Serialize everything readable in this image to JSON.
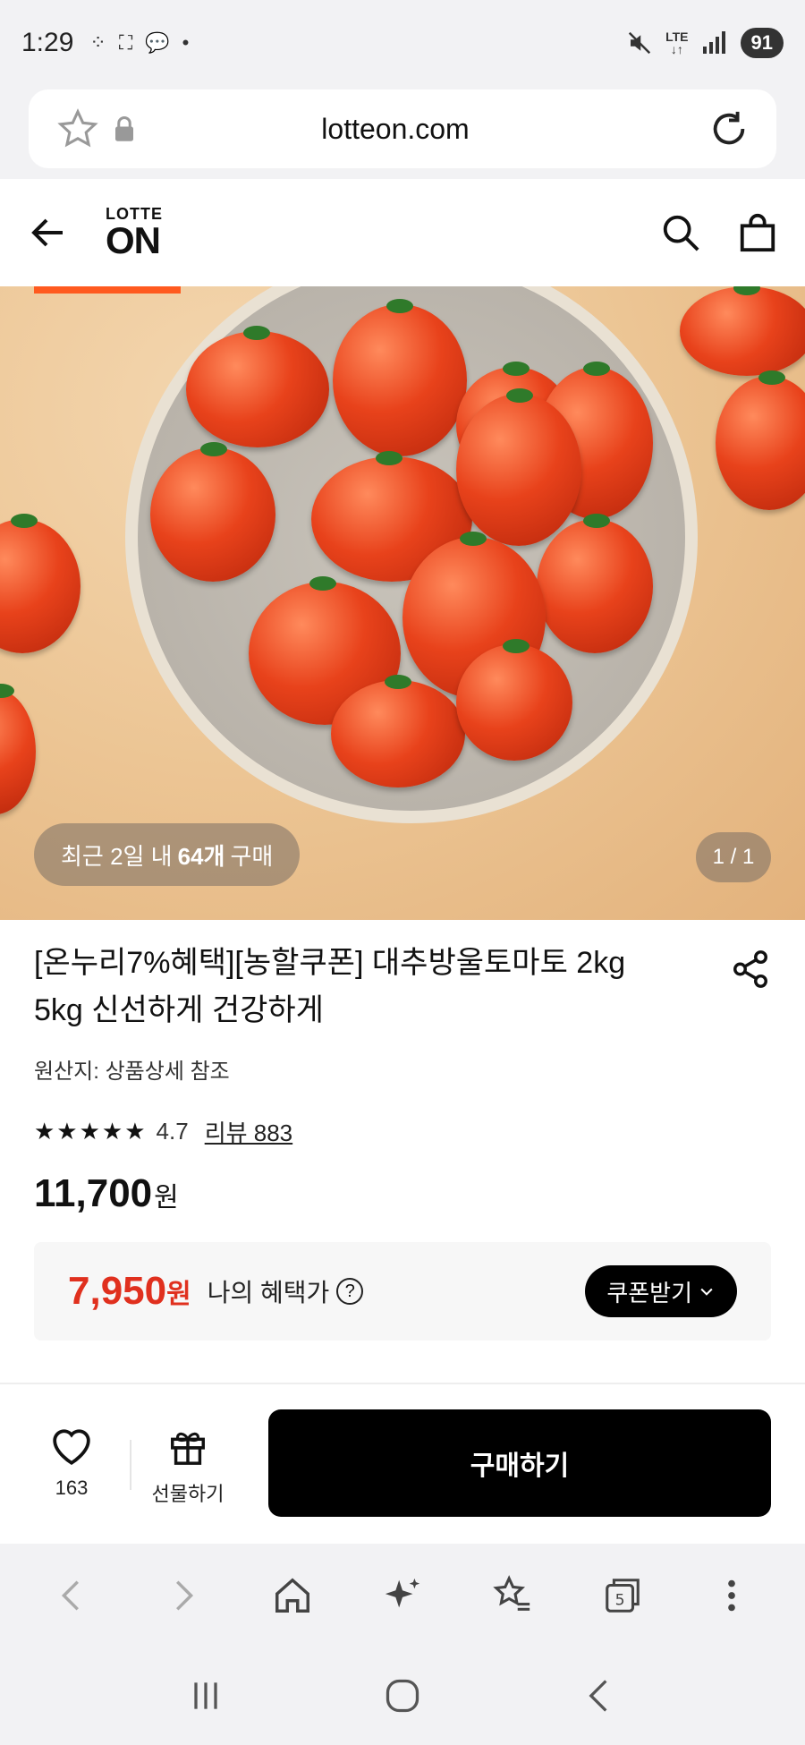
{
  "status_bar": {
    "time": "1:29",
    "battery": "91",
    "network": "LTE"
  },
  "browser": {
    "url": "lotteon.com"
  },
  "app_header": {
    "logo_top": "LOTTE",
    "logo_bottom": "ON"
  },
  "product_image": {
    "recent_prefix": "최근 2일 내",
    "recent_count": "64개",
    "recent_suffix": "구매",
    "page_counter": "1 / 1"
  },
  "product": {
    "title": "[온누리7%혜택][농할쿠폰] 대추방울토마토 2kg 5kg 신선하게 건강하게",
    "origin": "원산지: 상품상세 참조",
    "stars": "★★★★★",
    "rating": "4.7",
    "reviews": "리뷰 883",
    "price": "11,700",
    "price_unit": "원"
  },
  "benefit": {
    "price": "7,950",
    "unit": "원",
    "label": "나의 혜택가",
    "help": "?",
    "coupon_button": "쿠폰받기"
  },
  "action_bar": {
    "like_count": "163",
    "gift_label": "선물하기",
    "buy_label": "구매하기"
  },
  "browser_nav": {
    "tab_count": "5"
  },
  "colors": {
    "accent": "#ff5a1f",
    "benefit_red": "#e0301e",
    "buy_button": "#000000"
  }
}
